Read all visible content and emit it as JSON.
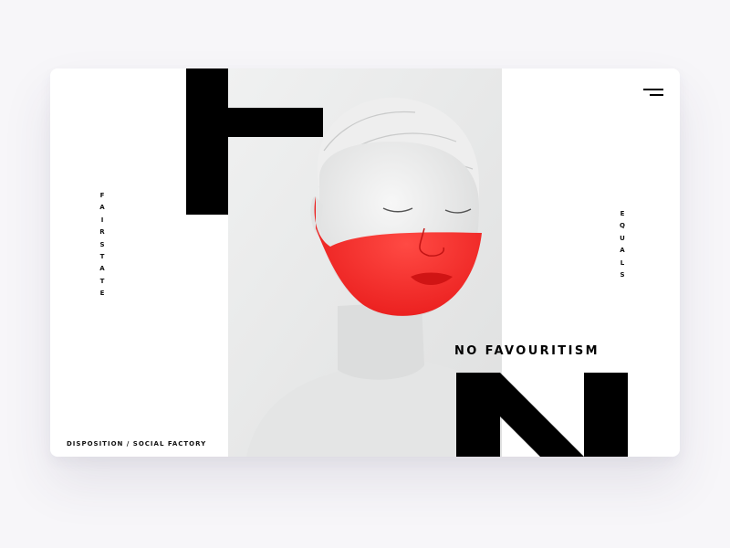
{
  "hero": {
    "headline": "NO FAVOURITISM",
    "left_vertical_word": "FAIRSTATE",
    "right_vertical_word": "EQUALS",
    "footer_caption": "DISPOSITION / SOCIAL FACTORY"
  },
  "icons": {
    "menu": "hamburger-menu-icon"
  },
  "colors": {
    "accent_red": "#ff2a2a",
    "text": "#000000",
    "page_background": "#f7f6f9",
    "card_background": "#ffffff",
    "photo_background": "#e9eaea"
  }
}
